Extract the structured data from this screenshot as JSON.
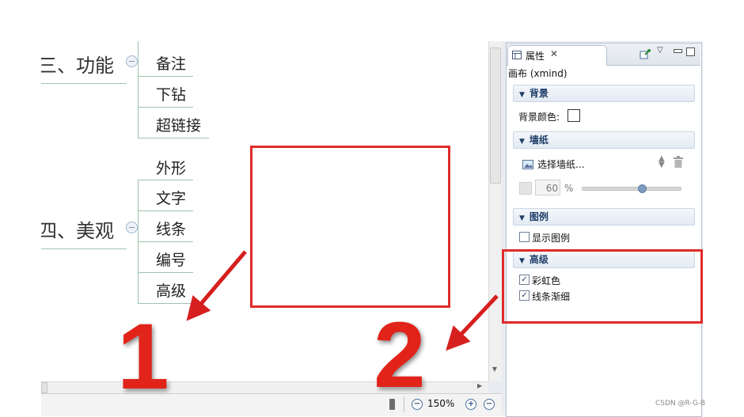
{
  "mindmap": {
    "topic3": "三、功能",
    "topic3_items": [
      "备注",
      "下钻",
      "超链接"
    ],
    "topic4": "四、美观",
    "topic4_items": [
      "外形",
      "文字",
      "线条",
      "编号",
      "高级"
    ]
  },
  "status": {
    "zoom": "150%"
  },
  "panel": {
    "tab_label": "属性",
    "subtitle": "画布 (xmind)",
    "background": {
      "title": "背景",
      "color_label": "背景颜色:"
    },
    "wallpaper": {
      "title": "墙纸",
      "select_label": "选择墙纸...",
      "opacity_value": "60",
      "opacity_unit": "%",
      "slider_value_fraction": 0.6
    },
    "legend": {
      "title": "图例",
      "show_label": "显示图例",
      "show_checked": false
    },
    "advanced": {
      "title": "高级",
      "items": [
        {
          "label": "彩虹色",
          "checked": true
        },
        {
          "label": "线条渐细",
          "checked": true
        }
      ]
    }
  },
  "annotations": {
    "num1": "1",
    "num2": "2"
  },
  "watermark": "CSDN @R-G-B",
  "colors": {
    "highlight_red": "#e12a2a",
    "section_blue": "#1f3f69"
  }
}
